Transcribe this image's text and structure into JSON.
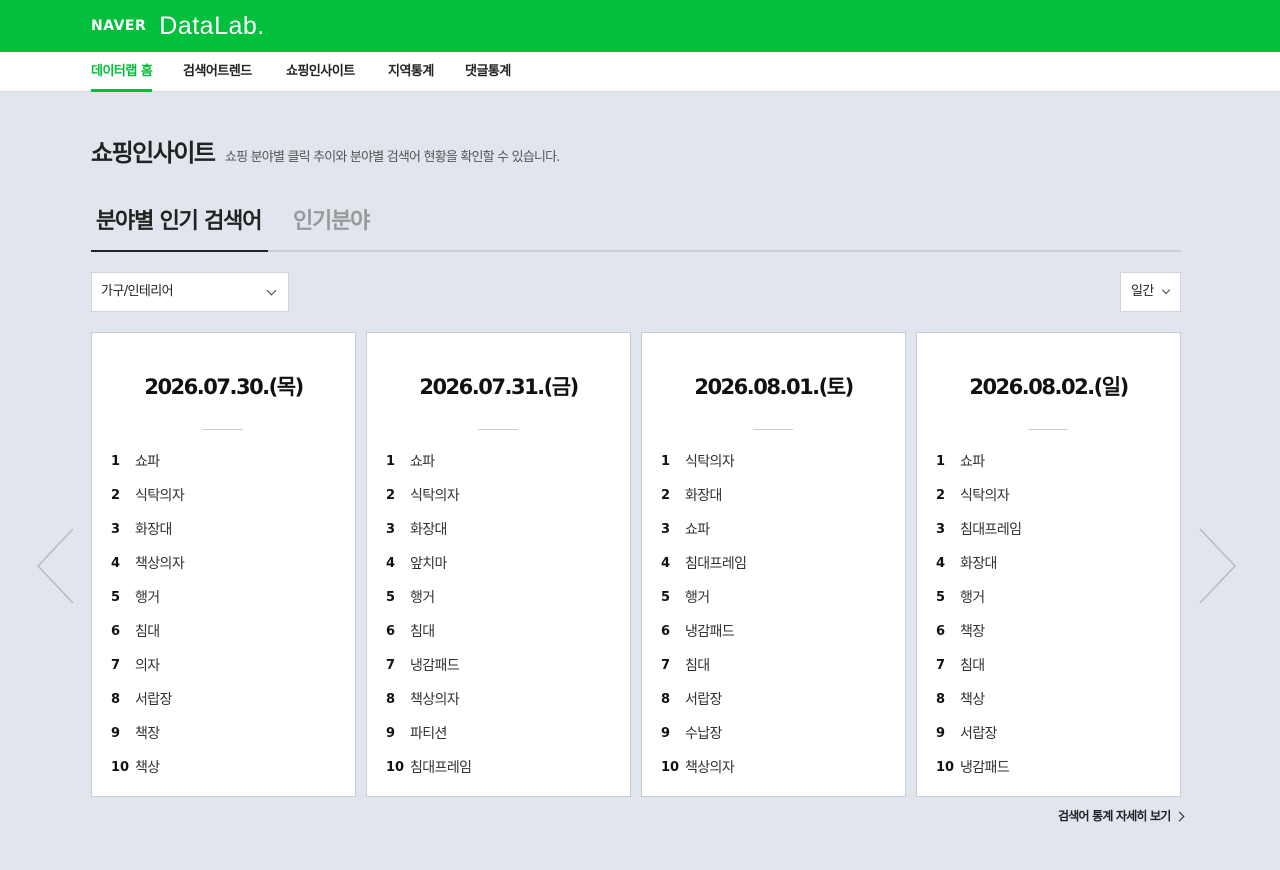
{
  "header": {
    "brand_naver": "NAVER",
    "brand_datalab": "DataLab."
  },
  "nav": {
    "items": [
      {
        "label": "데이터랩 홈",
        "active": true
      },
      {
        "label": "검색어트렌드",
        "active": false
      },
      {
        "label": "쇼핑인사이트",
        "active": false
      },
      {
        "label": "지역통계",
        "active": false
      },
      {
        "label": "댓글통계",
        "active": false
      }
    ]
  },
  "page": {
    "title": "쇼핑인사이트",
    "description": "쇼핑 분야별 클릭 추이와 분야별 검색어 현황을 확인할 수 있습니다."
  },
  "tabs": [
    {
      "label": "분야별 인기 검색어",
      "active": true
    },
    {
      "label": "인기분야",
      "active": false
    }
  ],
  "filters": {
    "category": "가구/인테리어",
    "period": "일간"
  },
  "cards": [
    {
      "date": "2026.07.30.(목)",
      "ranks": [
        {
          "rank": "1",
          "term": "쇼파"
        },
        {
          "rank": "2",
          "term": "식탁의자"
        },
        {
          "rank": "3",
          "term": "화장대"
        },
        {
          "rank": "4",
          "term": "책상의자"
        },
        {
          "rank": "5",
          "term": "행거"
        },
        {
          "rank": "6",
          "term": "침대"
        },
        {
          "rank": "7",
          "term": "의자"
        },
        {
          "rank": "8",
          "term": "서랍장"
        },
        {
          "rank": "9",
          "term": "책장"
        },
        {
          "rank": "10",
          "term": "책상"
        }
      ]
    },
    {
      "date": "2026.07.31.(금)",
      "ranks": [
        {
          "rank": "1",
          "term": "쇼파"
        },
        {
          "rank": "2",
          "term": "식탁의자"
        },
        {
          "rank": "3",
          "term": "화장대"
        },
        {
          "rank": "4",
          "term": "앞치마"
        },
        {
          "rank": "5",
          "term": "행거"
        },
        {
          "rank": "6",
          "term": "침대"
        },
        {
          "rank": "7",
          "term": "냉감패드"
        },
        {
          "rank": "8",
          "term": "책상의자"
        },
        {
          "rank": "9",
          "term": "파티션"
        },
        {
          "rank": "10",
          "term": "침대프레임"
        }
      ]
    },
    {
      "date": "2026.08.01.(토)",
      "ranks": [
        {
          "rank": "1",
          "term": "식탁의자"
        },
        {
          "rank": "2",
          "term": "화장대"
        },
        {
          "rank": "3",
          "term": "쇼파"
        },
        {
          "rank": "4",
          "term": "침대프레임"
        },
        {
          "rank": "5",
          "term": "행거"
        },
        {
          "rank": "6",
          "term": "냉감패드"
        },
        {
          "rank": "7",
          "term": "침대"
        },
        {
          "rank": "8",
          "term": "서랍장"
        },
        {
          "rank": "9",
          "term": "수납장"
        },
        {
          "rank": "10",
          "term": "책상의자"
        }
      ]
    },
    {
      "date": "2026.08.02.(일)",
      "ranks": [
        {
          "rank": "1",
          "term": "쇼파"
        },
        {
          "rank": "2",
          "term": "식탁의자"
        },
        {
          "rank": "3",
          "term": "침대프레임"
        },
        {
          "rank": "4",
          "term": "화장대"
        },
        {
          "rank": "5",
          "term": "행거"
        },
        {
          "rank": "6",
          "term": "책장"
        },
        {
          "rank": "7",
          "term": "침대"
        },
        {
          "rank": "8",
          "term": "책상"
        },
        {
          "rank": "9",
          "term": "서랍장"
        },
        {
          "rank": "10",
          "term": "냉감패드"
        }
      ]
    }
  ],
  "more_link": "검색어 통계 자세히 보기",
  "icons": {
    "prev": "chevron-left-icon",
    "next": "chevron-right-icon",
    "dropdown": "chevron-down-icon"
  },
  "colors": {
    "brand_green": "#03c03c",
    "background": "#e1e5ed"
  }
}
